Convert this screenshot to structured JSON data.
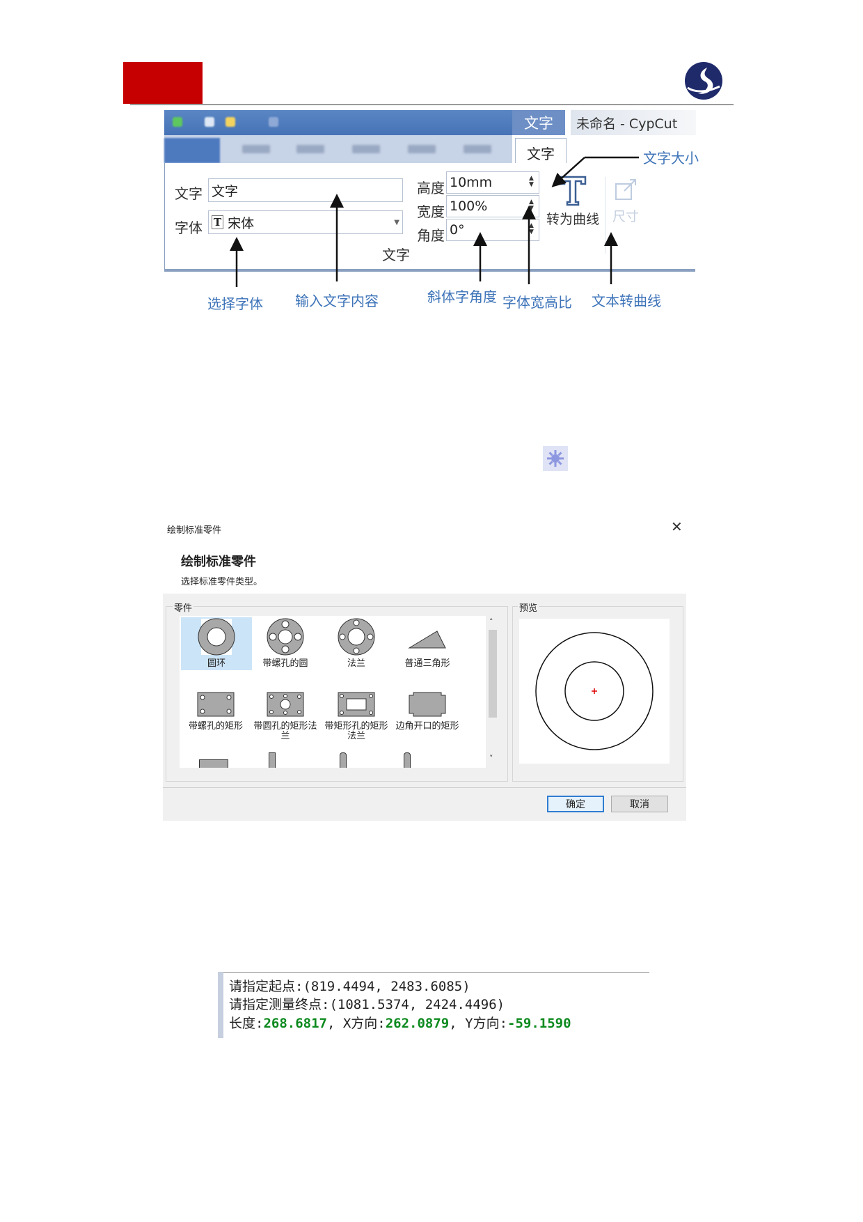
{
  "ribbon": {
    "context_tab": "文字",
    "window_title": "未命名 - CypCut",
    "selected_tab": "文字",
    "text_label": "文字",
    "text_value": "文字",
    "font_label": "字体",
    "font_value": "宋体",
    "height_label": "高度",
    "height_value": "10mm",
    "width_label": "宽度",
    "width_value": "100%",
    "angle_label": "角度",
    "angle_value": "0°",
    "group_label": "文字",
    "curve_label": "转为曲线",
    "size_label": "尺寸"
  },
  "annotations": {
    "font_size": "文字大小",
    "select_font": "选择字体",
    "input_text": "输入文字内容",
    "italic_angle": "斜体字角度",
    "aspect_ratio": "字体宽高比",
    "to_curve": "文本转曲线"
  },
  "dialog": {
    "window_title": "绘制标准零件",
    "heading": "绘制标准零件",
    "subtitle": "选择标准零件类型。",
    "parts_group": "零件",
    "preview_group": "预览",
    "parts": [
      {
        "label": "圆环"
      },
      {
        "label": "带螺孔的圆"
      },
      {
        "label": "法兰"
      },
      {
        "label": "普通三角形"
      },
      {
        "label": "带螺孔的矩形"
      },
      {
        "label": "带圆孔的矩形法兰"
      },
      {
        "label": "带矩形孔的矩形法兰"
      },
      {
        "label": "边角开口的矩形"
      }
    ],
    "ok_label": "确定",
    "cancel_label": "取消"
  },
  "console": {
    "line1": "请指定起点:(819.4494, 2483.6085)",
    "line2": "请指定测量终点:(1081.5374, 2424.4496)",
    "length_label": "长度:",
    "length_value": "268.6817",
    "x_label": ", X方向:",
    "x_value": "262.0879",
    "y_label": ", Y方向:",
    "y_value": "-59.1590"
  },
  "colors": {
    "brand_red": "#c60000",
    "annotation_blue": "#3d73b8",
    "console_green": "#0d8a1f",
    "selection_blue": "#cce4f7"
  }
}
